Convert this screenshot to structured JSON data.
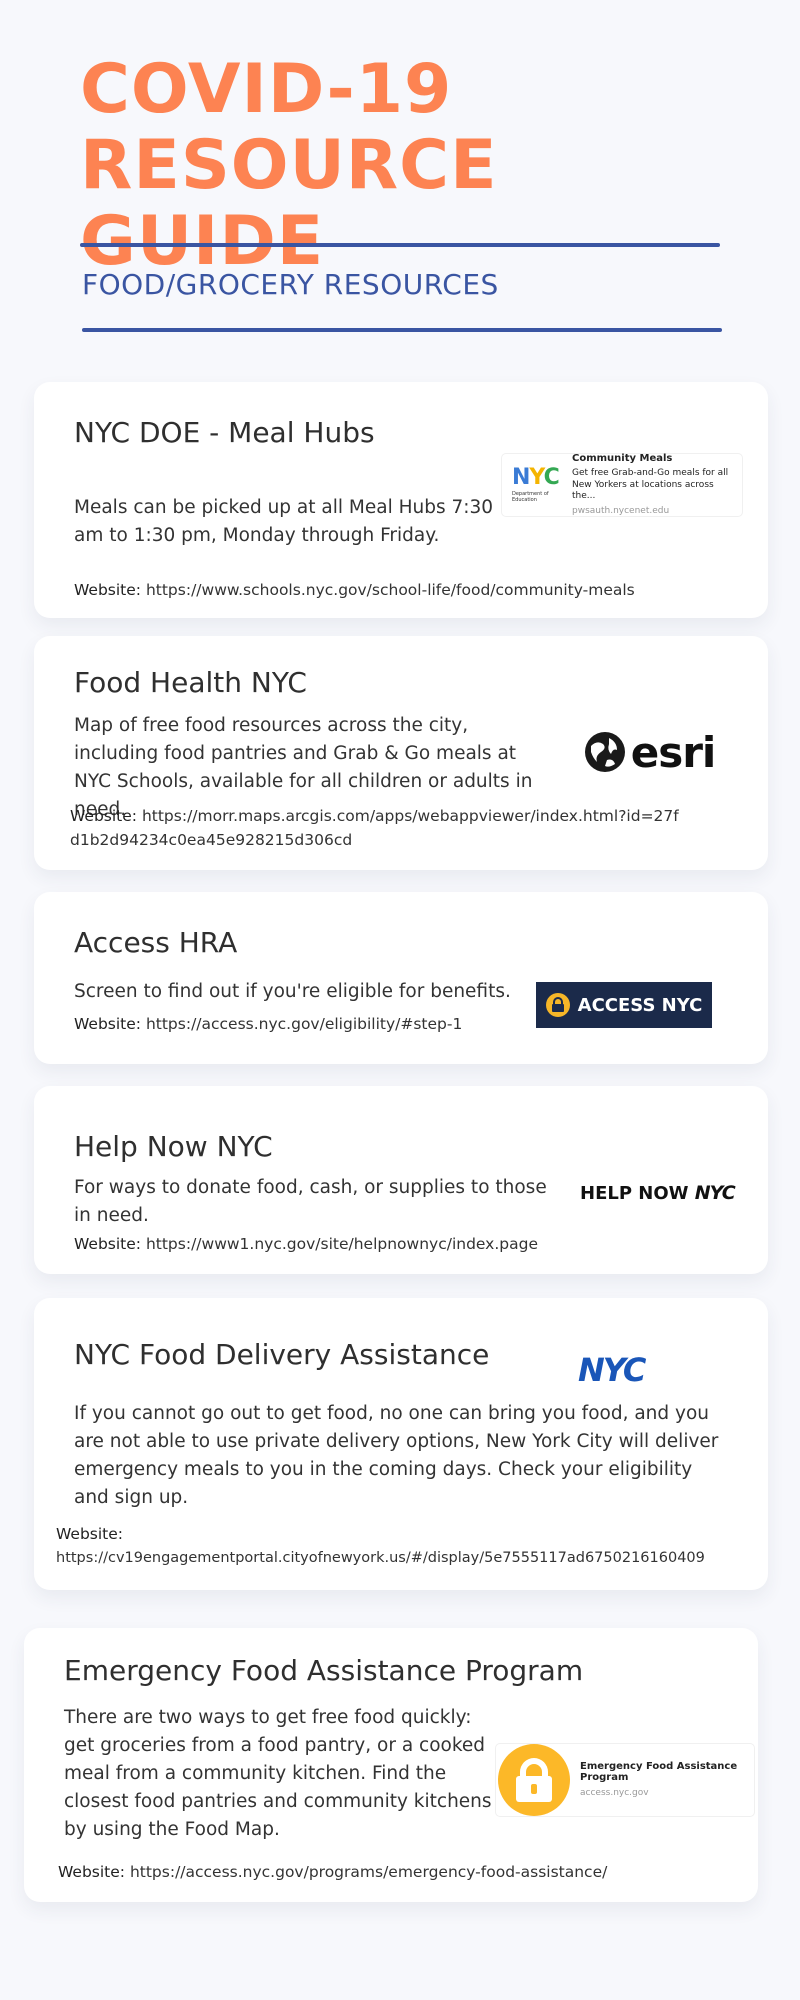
{
  "header": {
    "title_line1": "COVID-19",
    "title_line2": "RESOURCE GUIDE",
    "subtitle": "FOOD/GROCERY RESOURCES"
  },
  "colors": {
    "accent": "#fd8352",
    "brand_blue": "#3a55a2",
    "background": "#f7f8fc"
  },
  "cards": [
    {
      "title": "NYC DOE - Meal Hubs",
      "description": "Meals can be picked up at all Meal Hubs 7:30 am to 1:30 pm, Monday through Friday.",
      "website_label": "Website:",
      "website_url": "https://www.schools.nyc.gov/school-life/food/community-meals",
      "preview": {
        "logo_text": "NYC",
        "logo_sub": "Department of Education",
        "title": "Community Meals",
        "text": "Get free Grab-and-Go meals for all New Yorkers at locations across the...",
        "domain": "pwsauth.nycenet.edu"
      }
    },
    {
      "title": "Food Health NYC",
      "description": "Map of free food resources across the city, including food pantries and Grab & Go meals at NYC Schools, available for all children or adults in need.",
      "website_label": "Website:",
      "website_url": "https://morr.maps.arcgis.com/apps/webappviewer/index.html?id=27fd1b2d94234c0ea45e928215d306cd",
      "logo": {
        "text": "esri",
        "icon": "globe-icon"
      }
    },
    {
      "title": "Access HRA",
      "description": "Screen to find out if you're eligible for benefits.",
      "website_label": "Website:",
      "website_url": "https://access.nyc.gov/eligibility/#step-1",
      "logo": {
        "text": "ACCESS NYC",
        "icon": "lock-icon"
      }
    },
    {
      "title": "Help Now NYC",
      "description": "For ways to donate food, cash, or supplies to those in need.",
      "website_label": "Website:",
      "website_url": "https://www1.nyc.gov/site/helpnownyc/index.page",
      "logo": {
        "text_a": "HELP NOW ",
        "text_b": "NYC"
      }
    },
    {
      "title": "NYC Food Delivery Assistance",
      "description": "If you cannot go out to get food, no one can bring you food, and you are not able to use private delivery options, New York City will deliver emergency meals to you in the coming days. Check your eligibility and sign up.",
      "website_label": "Website:",
      "website_url": "https://cv19engagementportal.cityofnewyork.us/#/display/5e7555117ad6750216160409",
      "logo": {
        "text": "NYC"
      }
    },
    {
      "title": "Emergency Food Assistance Program",
      "description": "There are two ways to get free food quickly: get groceries from a food pantry, or a cooked meal from a community kitchen. Find the closest food pantries and community kitchens by using the Food Map.",
      "website_label": "Website:",
      "website_url": "https://access.nyc.gov/programs/emergency-food-assistance/",
      "preview": {
        "title": "Emergency Food Assistance Program",
        "domain": "access.nyc.gov"
      }
    }
  ]
}
